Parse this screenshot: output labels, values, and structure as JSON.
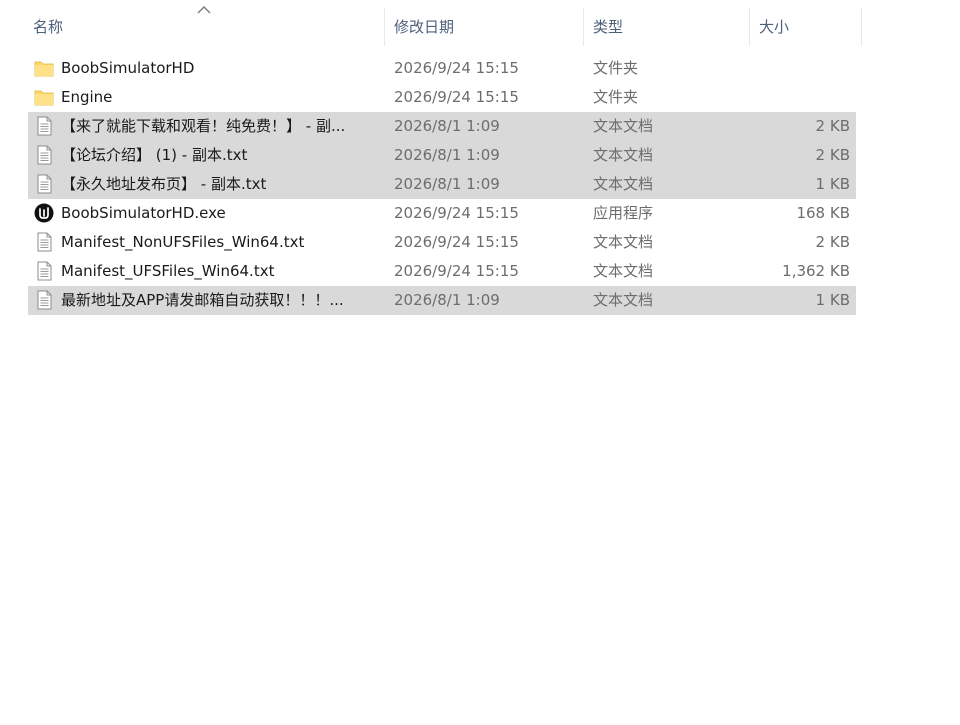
{
  "columns": {
    "name": "名称",
    "date": "修改日期",
    "type": "类型",
    "size": "大小"
  },
  "files": [
    {
      "icon": "folder-icon",
      "name": "BoobSimulatorHD",
      "date": "2026/9/24 15:15",
      "type": "文件夹",
      "size": "",
      "selected": false
    },
    {
      "icon": "folder-icon",
      "name": "Engine",
      "date": "2026/9/24 15:15",
      "type": "文件夹",
      "size": "",
      "selected": false
    },
    {
      "icon": "text-file-icon",
      "name": "【来了就能下载和观看！纯免费！】 - 副...",
      "date": "2026/8/1 1:09",
      "type": "文本文档",
      "size": "2 KB",
      "selected": true
    },
    {
      "icon": "text-file-icon",
      "name": "【论坛介绍】 (1) - 副本.txt",
      "date": "2026/8/1 1:09",
      "type": "文本文档",
      "size": "2 KB",
      "selected": true
    },
    {
      "icon": "text-file-icon",
      "name": "【永久地址发布页】  - 副本.txt",
      "date": "2026/8/1 1:09",
      "type": "文本文档",
      "size": "1 KB",
      "selected": true
    },
    {
      "icon": "unreal-engine-icon",
      "name": "BoobSimulatorHD.exe",
      "date": "2026/9/24 15:15",
      "type": "应用程序",
      "size": "168 KB",
      "selected": false
    },
    {
      "icon": "text-file-icon",
      "name": "Manifest_NonUFSFiles_Win64.txt",
      "date": "2026/9/24 15:15",
      "type": "文本文档",
      "size": "2 KB",
      "selected": false
    },
    {
      "icon": "text-file-icon",
      "name": "Manifest_UFSFiles_Win64.txt",
      "date": "2026/9/24 15:15",
      "type": "文本文档",
      "size": "1,362 KB",
      "selected": false
    },
    {
      "icon": "text-file-icon",
      "name": "最新地址及APP请发邮箱自动获取！！！...",
      "date": "2026/8/1 1:09",
      "type": "文本文档",
      "size": "1 KB",
      "selected": true
    }
  ],
  "colors": {
    "selection": "#d9d9d9",
    "folder": "#ffd769",
    "header_text": "#4c607a",
    "detail_text": "#6d6d6d"
  }
}
